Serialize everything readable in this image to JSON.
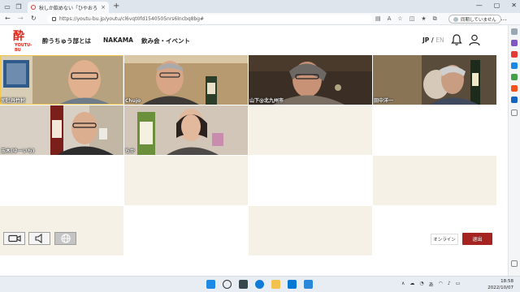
{
  "browser": {
    "tab_title": "秋しか飲めない「ひやおろし」を…",
    "url": "https://youtu-bu.jp/youtu/cl6vqt0fd1540505nrs6lncbq8bg#",
    "sync_label": "同期していません",
    "tab_close": "×",
    "new_tab": "+",
    "more": "…"
  },
  "site": {
    "logo_sub": "YOUTU-BU",
    "nav": [
      "酔うちゅう部とは",
      "NAKAMA",
      "飲み会・イベント"
    ],
    "lang_jp": "JP",
    "lang_sep": " / ",
    "lang_en": "EN"
  },
  "participants": [
    {
      "name": "司牡丹竹村"
    },
    {
      "name": "Chujo"
    },
    {
      "name": "山下@北九州市"
    },
    {
      "name": "田中洋一"
    },
    {
      "name": "玉木(ゆーいち)"
    },
    {
      "name": "ちか"
    }
  ],
  "controls": {
    "online_label": "オンライン",
    "leave_label": "退出"
  },
  "taskbar": {
    "time": "18:58",
    "date": "2022/10/07",
    "ime": "あ"
  },
  "colors": {
    "accent_red": "#e0261b",
    "leave_button": "#a52422",
    "empty_cell_cream": "#f5f1e6",
    "active_speaker": "#f2c94c"
  }
}
